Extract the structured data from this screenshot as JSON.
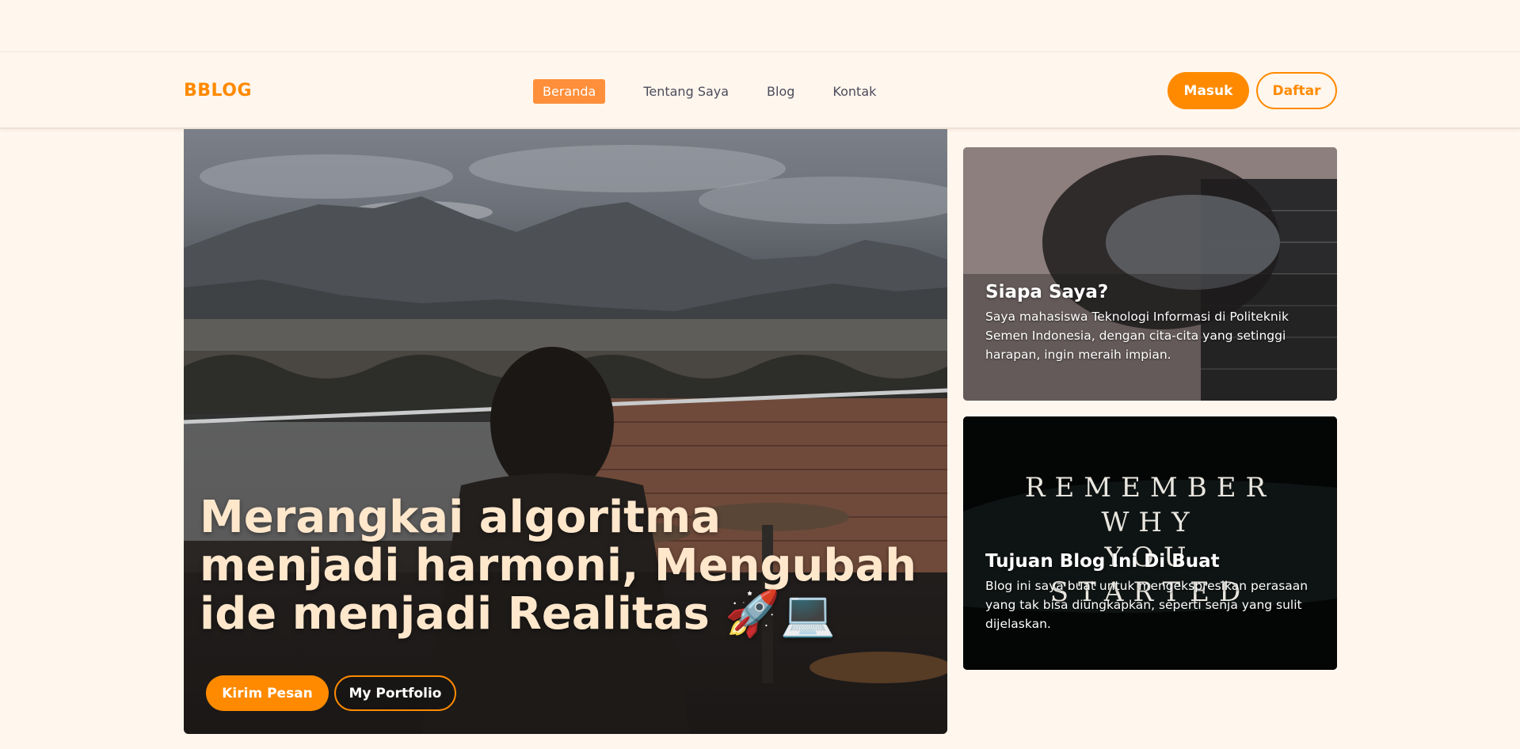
{
  "brand": "BBLOG",
  "nav": {
    "links": [
      "Beranda",
      "Tentang Saya",
      "Blog",
      "Kontak"
    ],
    "active_index": 0
  },
  "auth": {
    "login_label": "Masuk",
    "register_label": "Daftar"
  },
  "hero": {
    "title_line1": "Merangkai algoritma",
    "title_line2": "menjadi harmoni, Mengubah",
    "title_line3": "ide menjadi Realitas 🚀💻",
    "primary_button": "Kirim Pesan",
    "secondary_button": "My Portfolio"
  },
  "cards": [
    {
      "title": "Siapa Saya?",
      "text": "Saya mahasiswa Teknologi Informasi di Politeknik Semen Indonesia, dengan cita-cita yang setinggi harapan, ingin meraih impian."
    },
    {
      "title": "Tujuan Blog Ini Di Buat",
      "text": "Blog ini saya buat untuk mengekspresikan perasaan yang tak bisa diungkapkan, seperti senja yang sulit dijelaskan.",
      "poster_lines": [
        "REMEMBER",
        "WHY",
        "YOU",
        "STARTED"
      ]
    }
  ],
  "colors": {
    "accent": "#ff8a00",
    "background": "#fff6ed",
    "hero_text": "#ffe7cc"
  }
}
